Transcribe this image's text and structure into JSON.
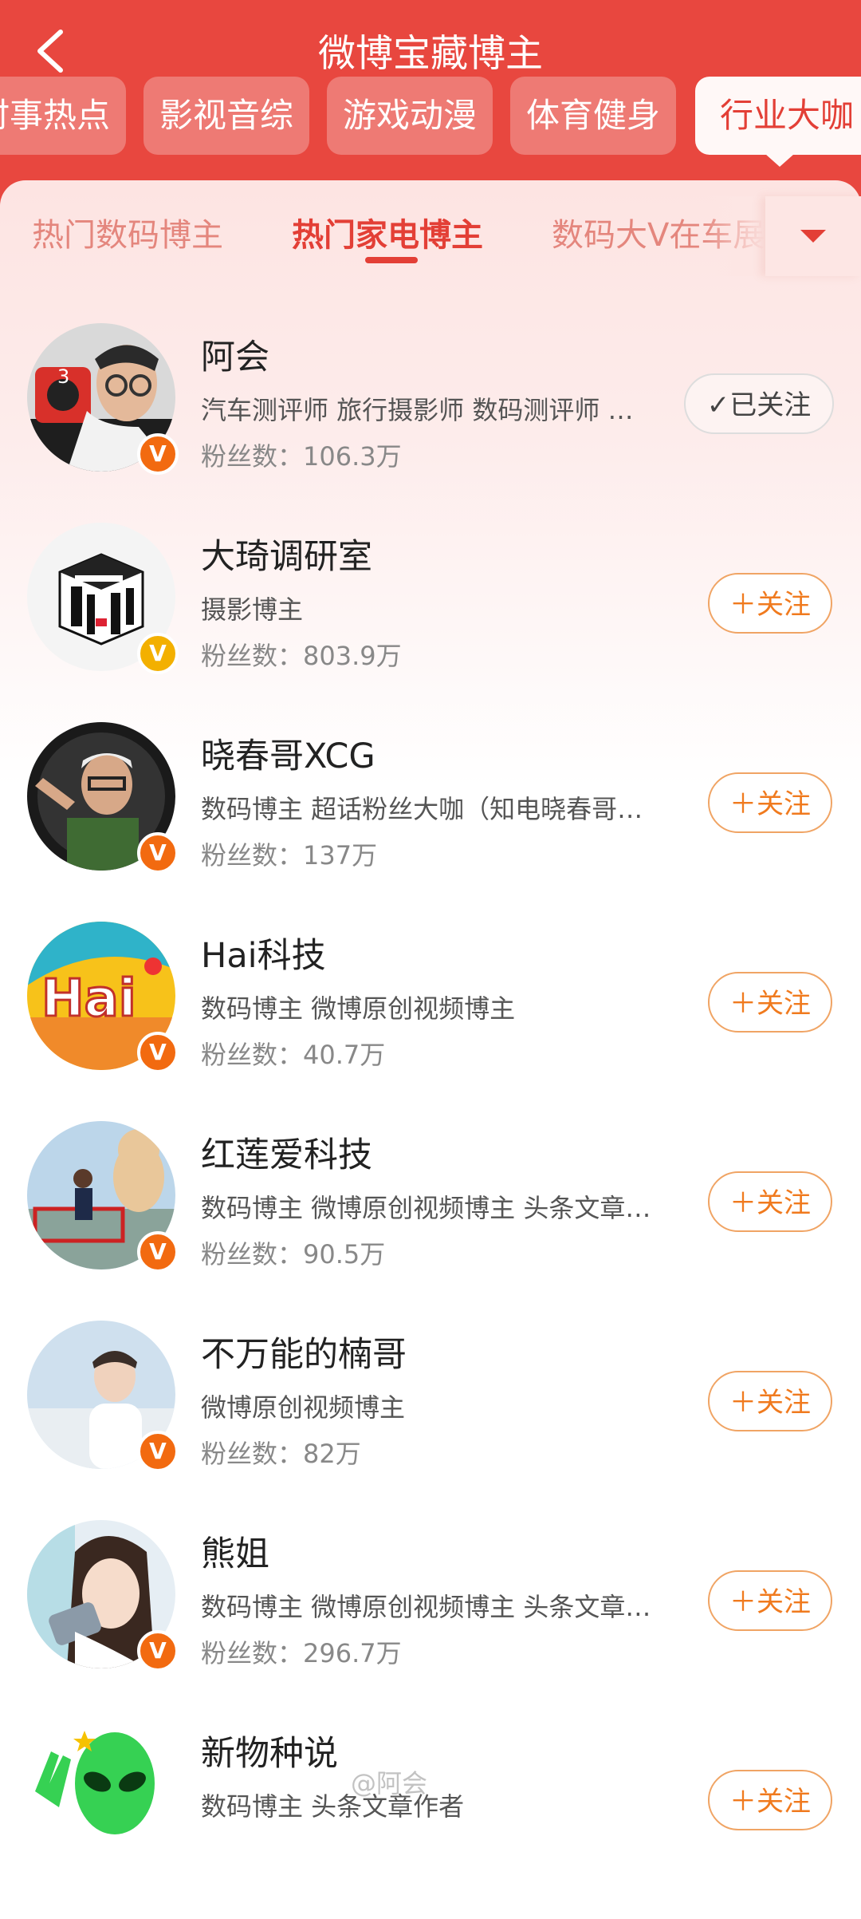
{
  "header": {
    "title": "微博宝藏博主",
    "categories": [
      "时事热点",
      "影视音综",
      "游戏动漫",
      "体育健身",
      "行业大咖"
    ]
  },
  "subtabs": [
    "热门数码博主",
    "热门家电博主",
    "数码大V在车展"
  ],
  "bloggers": [
    {
      "name": "阿会",
      "tags": "汽车测评师 旅行摄影师 数码测评师 …",
      "fans": "粉丝数：106.3万",
      "follow": "已关注",
      "followed": true
    },
    {
      "name": "大琦调研室",
      "tags": "摄影博主",
      "fans": "粉丝数：803.9万",
      "follow": "关注",
      "followed": false
    },
    {
      "name": "晓春哥XCG",
      "tags": "数码博主 超话粉丝大咖（知电晓春哥…",
      "fans": "粉丝数：137万",
      "follow": "关注",
      "followed": false
    },
    {
      "name": "Hai科技",
      "tags": "数码博主 微博原创视频博主",
      "fans": "粉丝数：40.7万",
      "follow": "关注",
      "followed": false
    },
    {
      "name": "红莲爱科技",
      "tags": "数码博主 微博原创视频博主 头条文章…",
      "fans": "粉丝数：90.5万",
      "follow": "关注",
      "followed": false
    },
    {
      "name": "不万能的楠哥",
      "tags": "微博原创视频博主",
      "fans": "粉丝数：82万",
      "follow": "关注",
      "followed": false
    },
    {
      "name": "熊姐",
      "tags": "数码博主 微博原创视频博主 头条文章…",
      "fans": "粉丝数：296.7万",
      "follow": "关注",
      "followed": false
    },
    {
      "name": "新物种说",
      "tags": "数码博主 头条文章作者",
      "fans": "",
      "follow": "关注",
      "followed": false
    }
  ],
  "watermark": "@阿会",
  "colors": {
    "brand_red": "#e8473f",
    "follow_orange": "#f07a1e",
    "badge_orange": "#f26a10",
    "badge_gold": "#f3b000"
  }
}
